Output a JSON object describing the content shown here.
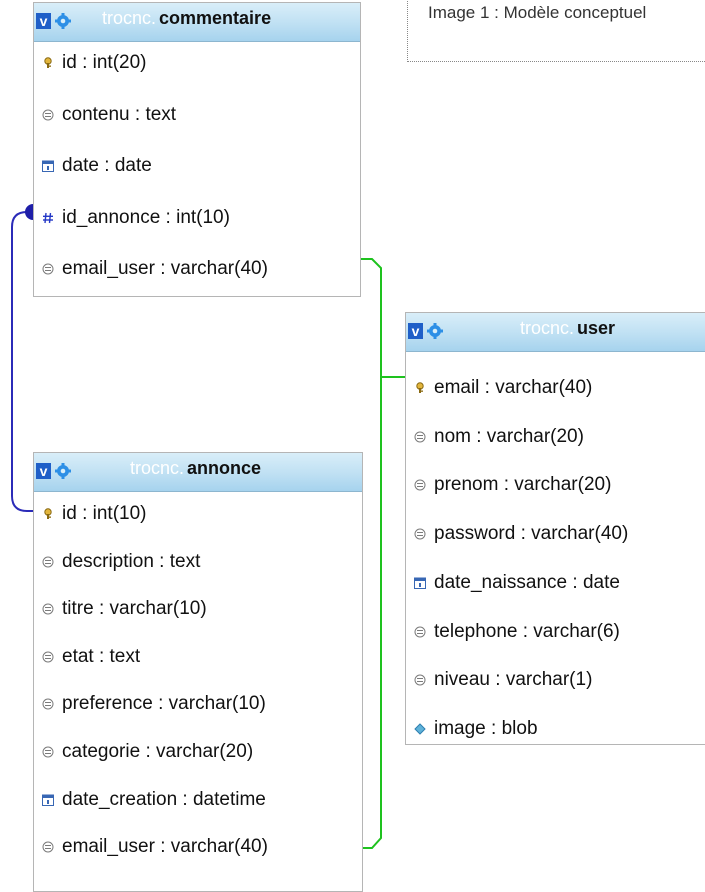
{
  "caption": "Image 1 : Modèle conceptuel",
  "tables": {
    "commentaire": {
      "schema": "trocnc.",
      "name": "commentaire",
      "columns": [
        {
          "text": "id : int(20)",
          "icon": "key-icon"
        },
        {
          "text": "contenu : text",
          "icon": "column-icon"
        },
        {
          "text": "date : date",
          "icon": "date-icon"
        },
        {
          "text": "id_annonce : int(10)",
          "icon": "number-icon"
        },
        {
          "text": "email_user : varchar(40)",
          "icon": "column-icon"
        }
      ]
    },
    "annonce": {
      "schema": "trocnc.",
      "name": "annonce",
      "columns": [
        {
          "text": "id : int(10)",
          "icon": "key-icon"
        },
        {
          "text": "description : text",
          "icon": "column-icon"
        },
        {
          "text": "titre : varchar(10)",
          "icon": "column-icon"
        },
        {
          "text": "etat : text",
          "icon": "column-icon"
        },
        {
          "text": "preference : varchar(10)",
          "icon": "column-icon"
        },
        {
          "text": "categorie : varchar(20)",
          "icon": "column-icon"
        },
        {
          "text": "date_creation : datetime",
          "icon": "date-icon"
        },
        {
          "text": "email_user : varchar(40)",
          "icon": "column-icon"
        }
      ]
    },
    "user": {
      "schema": "trocnc.",
      "name": "user",
      "columns": [
        {
          "text": "email : varchar(40)",
          "icon": "key-icon"
        },
        {
          "text": "nom : varchar(20)",
          "icon": "column-icon"
        },
        {
          "text": "prenom : varchar(20)",
          "icon": "column-icon"
        },
        {
          "text": "password : varchar(40)",
          "icon": "column-icon"
        },
        {
          "text": "date_naissance : date",
          "icon": "date-icon"
        },
        {
          "text": "telephone : varchar(6)",
          "icon": "column-icon"
        },
        {
          "text": "niveau : varchar(1)",
          "icon": "column-icon"
        },
        {
          "text": "image : blob",
          "icon": "blob-icon"
        }
      ]
    }
  },
  "colors": {
    "relation_blue": "#2b2bb8",
    "relation_green": "#1ec21e",
    "header_text_schema": "#ffffff"
  },
  "header_button": "v"
}
